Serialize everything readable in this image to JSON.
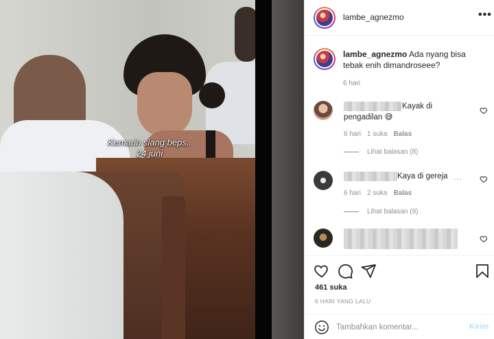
{
  "post": {
    "video_caption_line1": "Kemarin siang beps..",
    "video_caption_line2": "24 juni"
  },
  "header": {
    "username": "lambe_agnezmo",
    "more_icon": "more-horizontal-icon",
    "more_label": "•••"
  },
  "caption": {
    "username": "lambe_agnezmo",
    "text": " Ada nyang bisa tebak enih dimandroseee?",
    "time": "6 hari"
  },
  "comments": [
    {
      "text": "Kayak di pengadilan 😅",
      "text_line1": "Kayak di",
      "text_line2": "pengadilan 😅",
      "time": "6 hari",
      "likes": "1 suka",
      "reply": "Balas",
      "view_replies": "Lihat balasan (8)"
    },
    {
      "text": "Kaya di gereja",
      "ellipsis": "...",
      "time": "6 hari",
      "likes": "2 suka",
      "reply": "Balas",
      "view_replies": "Lihat balasan (9)"
    },
    {
      "text": ""
    }
  ],
  "actions": {
    "like_icon": "heart-outline-icon",
    "comment_icon": "comment-bubble-icon",
    "share_icon": "paper-plane-icon",
    "save_icon": "bookmark-icon",
    "likes_count": "461 suka",
    "posted_time": "6 HARI YANG LALU"
  },
  "comment_box": {
    "emoji_icon": "emoji-smile-icon",
    "placeholder": "Tambahkan komentar...",
    "post_label": "Kirim"
  },
  "colors": {
    "text": "#262626",
    "muted": "#8e8e8e",
    "border": "#efefef",
    "post_button_disabled": "#b2dffc"
  }
}
